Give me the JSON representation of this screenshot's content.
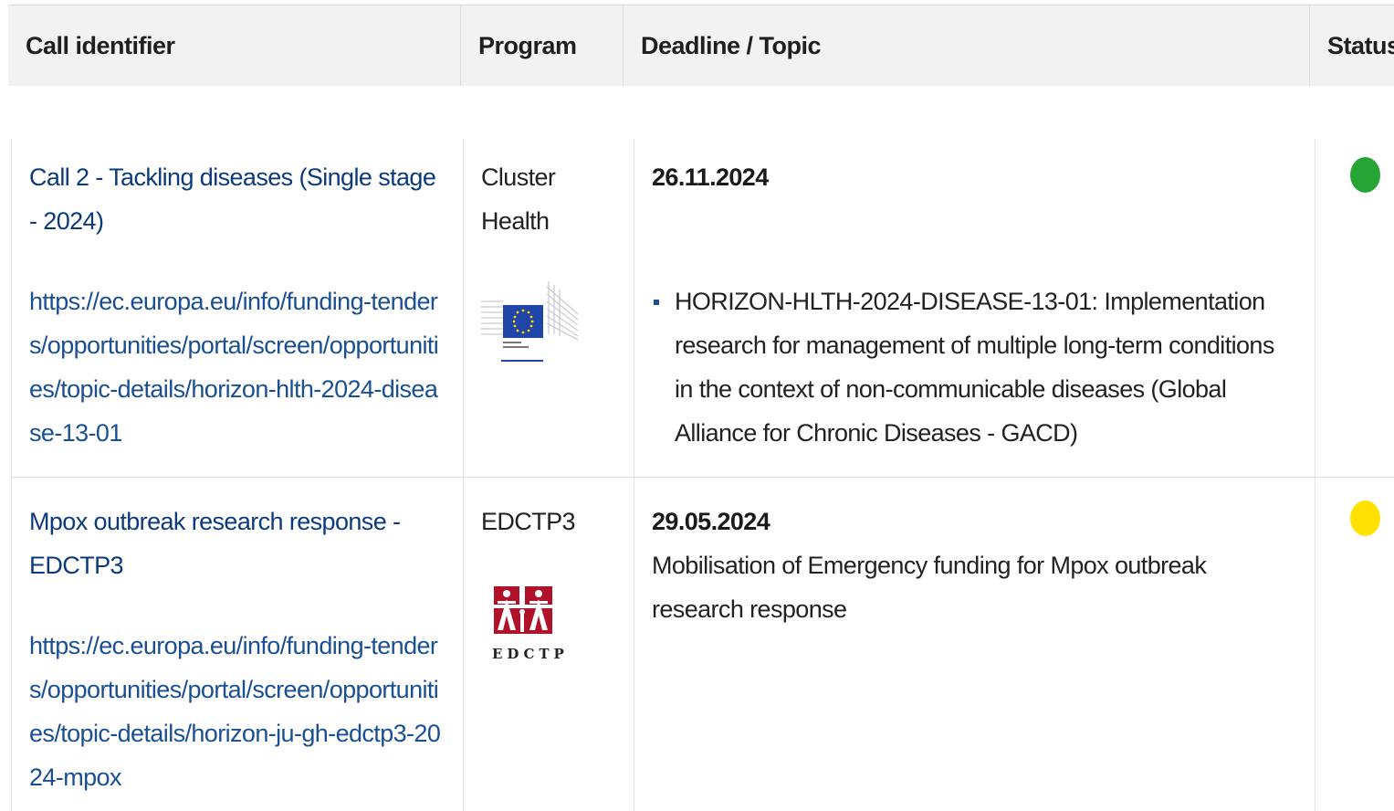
{
  "table": {
    "headers": {
      "call_identifier": "Call identifier",
      "program": "Program",
      "deadline_topic": "Deadline / Topic",
      "status": "Status"
    },
    "rows": [
      {
        "title": "Call 2 - Tackling diseases (Single stage - 2024)",
        "url": "https://ec.europa.eu/info/funding-tenders/opportunities/portal/screen/opportunities/topic-details/horizon-hlth-2024-disease-13-01",
        "program_line1": "Cluster",
        "program_line2": "Health",
        "logo": "european-commission-logo",
        "deadline": "26.11.2024",
        "topic": "HORIZON-HLTH-2024-DISEASE-13-01: Implementation research for management of multiple long-term conditions in the context of non-communicable diseases (Global Alliance for Chronic Diseases - GACD)",
        "status_color": "#27a534"
      },
      {
        "title": "Mpox outbreak research response - EDCTP3",
        "url": "https://ec.europa.eu/info/funding-tenders/opportunities/portal/screen/opportunities/topic-details/horizon-ju-gh-edctp3-2024-mpox",
        "program_line1": "EDCTP3",
        "logo": "edctp-logo",
        "logo_text": "EDCTP",
        "deadline": "29.05.2024",
        "topic": "Mobilisation of Emergency funding for Mpox outbreak research response",
        "status_color": "#ffe000"
      }
    ]
  }
}
